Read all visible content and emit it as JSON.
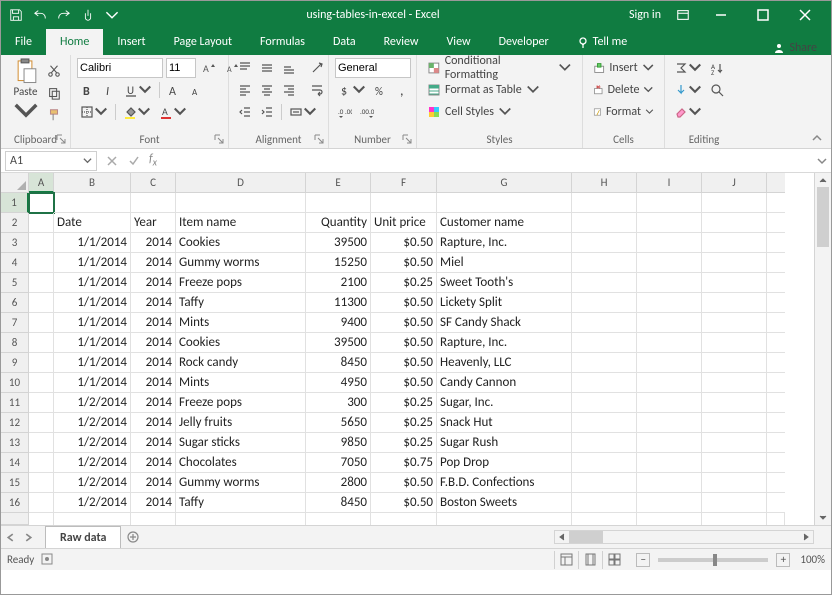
{
  "title": "using-tables-in-excel - Excel",
  "signin": "Sign in",
  "tabs": {
    "file": "File",
    "home": "Home",
    "insert": "Insert",
    "page_layout": "Page Layout",
    "formulas": "Formulas",
    "data": "Data",
    "review": "Review",
    "view": "View",
    "developer": "Developer",
    "tellme": "Tell me",
    "share": "Share"
  },
  "ribbon": {
    "clipboard": {
      "label": "Clipboard",
      "paste": "Paste"
    },
    "font": {
      "label": "Font",
      "name": "Calibri",
      "size": "11"
    },
    "alignment": {
      "label": "Alignment"
    },
    "number": {
      "label": "Number",
      "format": "General"
    },
    "styles": {
      "label": "Styles",
      "cond": "Conditional Formatting",
      "table": "Format as Table",
      "cell": "Cell Styles"
    },
    "cells": {
      "label": "Cells",
      "insert": "Insert",
      "delete": "Delete",
      "format": "Format"
    },
    "editing": {
      "label": "Editing"
    }
  },
  "namebox": "A1",
  "formula": "",
  "columns": [
    "A",
    "B",
    "C",
    "D",
    "E",
    "F",
    "G",
    "H",
    "I",
    "J"
  ],
  "headers": {
    "row": "2",
    "date": "Date",
    "year": "Year",
    "item": "Item name",
    "qty": "Quantity",
    "price": "Unit price",
    "cust": "Customer name"
  },
  "rows": [
    {
      "n": "3",
      "date": "1/1/2014",
      "year": "2014",
      "item": "Cookies",
      "qty": "39500",
      "price": "$0.50",
      "cust": "Rapture, Inc."
    },
    {
      "n": "4",
      "date": "1/1/2014",
      "year": "2014",
      "item": "Gummy worms",
      "qty": "15250",
      "price": "$0.50",
      "cust": "Miel"
    },
    {
      "n": "5",
      "date": "1/1/2014",
      "year": "2014",
      "item": "Freeze pops",
      "qty": "2100",
      "price": "$0.25",
      "cust": "Sweet Tooth's"
    },
    {
      "n": "6",
      "date": "1/1/2014",
      "year": "2014",
      "item": "Taffy",
      "qty": "11300",
      "price": "$0.50",
      "cust": "Lickety Split"
    },
    {
      "n": "7",
      "date": "1/1/2014",
      "year": "2014",
      "item": "Mints",
      "qty": "9400",
      "price": "$0.50",
      "cust": "SF Candy Shack"
    },
    {
      "n": "8",
      "date": "1/1/2014",
      "year": "2014",
      "item": "Cookies",
      "qty": "39500",
      "price": "$0.50",
      "cust": "Rapture, Inc."
    },
    {
      "n": "9",
      "date": "1/1/2014",
      "year": "2014",
      "item": "Rock candy",
      "qty": "8450",
      "price": "$0.50",
      "cust": "Heavenly, LLC"
    },
    {
      "n": "10",
      "date": "1/1/2014",
      "year": "2014",
      "item": "Mints",
      "qty": "4950",
      "price": "$0.50",
      "cust": "Candy Cannon"
    },
    {
      "n": "11",
      "date": "1/2/2014",
      "year": "2014",
      "item": "Freeze pops",
      "qty": "300",
      "price": "$0.25",
      "cust": "Sugar, Inc."
    },
    {
      "n": "12",
      "date": "1/2/2014",
      "year": "2014",
      "item": "Jelly fruits",
      "qty": "5650",
      "price": "$0.25",
      "cust": "Snack Hut"
    },
    {
      "n": "13",
      "date": "1/2/2014",
      "year": "2014",
      "item": "Sugar sticks",
      "qty": "9850",
      "price": "$0.25",
      "cust": "Sugar Rush"
    },
    {
      "n": "14",
      "date": "1/2/2014",
      "year": "2014",
      "item": "Chocolates",
      "qty": "7050",
      "price": "$0.75",
      "cust": "Pop Drop"
    },
    {
      "n": "15",
      "date": "1/2/2014",
      "year": "2014",
      "item": "Gummy worms",
      "qty": "2800",
      "price": "$0.50",
      "cust": "F.B.D. Confections"
    },
    {
      "n": "16",
      "date": "1/2/2014",
      "year": "2014",
      "item": "Taffy",
      "qty": "8450",
      "price": "$0.50",
      "cust": "Boston Sweets"
    }
  ],
  "sheet_tab": "Raw data",
  "status": {
    "ready": "Ready",
    "zoom": "100%"
  }
}
